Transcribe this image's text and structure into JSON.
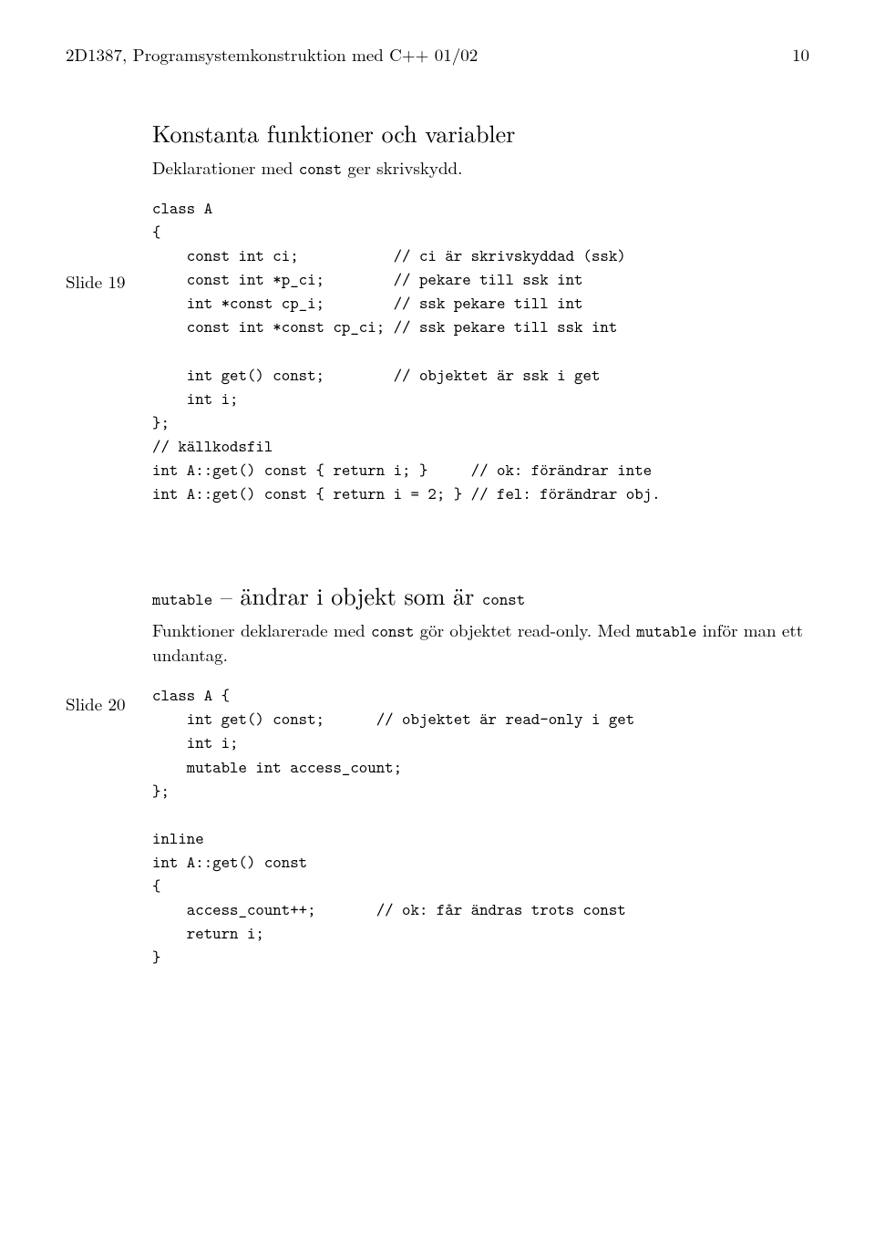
{
  "header": {
    "left": "2D1387, Programsystemkonstruktion med C++ 01/02",
    "page": "10"
  },
  "slide19": {
    "label": "Slide 19",
    "title": "Konstanta funktioner och variabler",
    "subtitle_pre": "Deklarationer med ",
    "subtitle_code": "const",
    "subtitle_post": " ger skrivskydd.",
    "code": "class A\n{\n    const int ci;           // ci är skrivskyddad (ssk)\n    const int *p_ci;        // pekare till ssk int\n    int *const cp_i;        // ssk pekare till int\n    const int *const cp_ci; // ssk pekare till ssk int\n\n    int get() const;        // objektet är ssk i get\n    int i;\n};\n// källkodsfil\nint A::get() const { return i; }     // ok: förändrar inte\nint A::get() const { return i = 2; } // fel: förändrar obj."
  },
  "slide20": {
    "label": "Slide 20",
    "title_code1": "mutable",
    "title_mid": " – ändrar i objekt som är ",
    "title_code2": "const",
    "subtitle_pre": "Funktioner deklarerade med ",
    "subtitle_code1": "const",
    "subtitle_mid": " gör objektet read-only. Med ",
    "subtitle_code2": "mutable",
    "subtitle_post": " inför man ett undantag.",
    "code": "class A {\n    int get() const;      // objektet är read-only i get\n    int i;\n    mutable int access_count;\n};\n\ninline\nint A::get() const\n{\n    access_count++;       // ok: får ändras trots const\n    return i;\n}"
  }
}
